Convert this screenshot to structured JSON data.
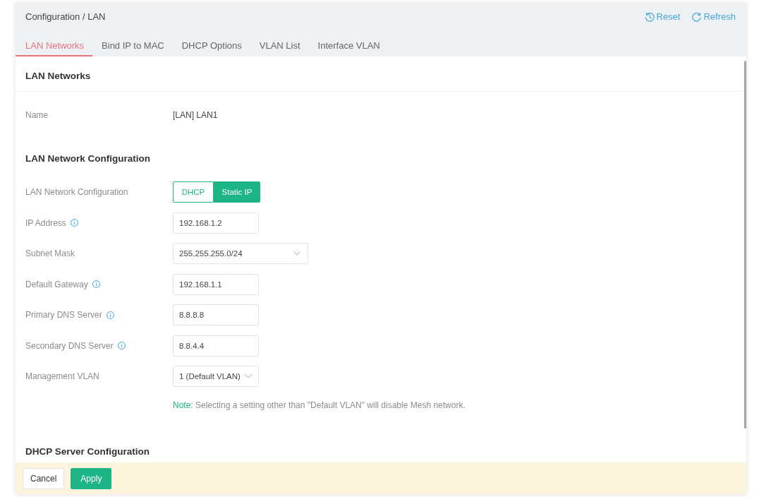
{
  "breadcrumb": "Configuration / LAN",
  "header_actions": [
    {
      "kind": "reset",
      "label": "Reset"
    },
    {
      "kind": "refresh",
      "label": "Refresh"
    }
  ],
  "tabs": [
    {
      "label": "LAN Networks",
      "selected": true
    },
    {
      "label": "Bind IP to MAC",
      "selected": false
    },
    {
      "label": "DHCP Options",
      "selected": false
    },
    {
      "label": "VLAN List",
      "selected": false
    },
    {
      "label": "Interface VLAN",
      "selected": false
    }
  ],
  "lan_networks": {
    "title": "LAN Networks",
    "name": {
      "label": "Name",
      "value": "[LAN] LAN1"
    }
  },
  "lan_config": {
    "title": "LAN Network Configuration",
    "fields": [
      {
        "kind": "segmented",
        "label": "LAN Network Configuration",
        "info": false,
        "options": [
          {
            "label": "DHCP",
            "selected": false
          },
          {
            "label": "Static IP",
            "selected": true
          }
        ]
      },
      {
        "kind": "input",
        "label": "IP Address",
        "info": true,
        "value": "192.168.1.2"
      },
      {
        "kind": "select",
        "label": "Subnet Mask",
        "info": false,
        "value": "255.255.255.0/24"
      },
      {
        "kind": "input",
        "label": "Default Gateway",
        "info": true,
        "value": "192.168.1.1"
      },
      {
        "kind": "input",
        "label": "Primary DNS Server",
        "info": true,
        "value": "8.8.8.8"
      },
      {
        "kind": "input",
        "label": "Secondary DNS Server",
        "info": true,
        "value": "8.8.4.4"
      },
      {
        "kind": "inline-select",
        "label": "Management VLAN",
        "info": false,
        "value": "1 (Default VLAN)"
      }
    ],
    "note": {
      "prefix": "Note:",
      "text": "Selecting a setting other than \"Default VLAN\" will disable Mesh network."
    }
  },
  "dhcp_server": {
    "title": "DHCP Server Configuration"
  },
  "footer": {
    "buttons": [
      {
        "kind": "secondary",
        "label": "Cancel"
      },
      {
        "kind": "primary",
        "label": "Apply"
      }
    ]
  }
}
